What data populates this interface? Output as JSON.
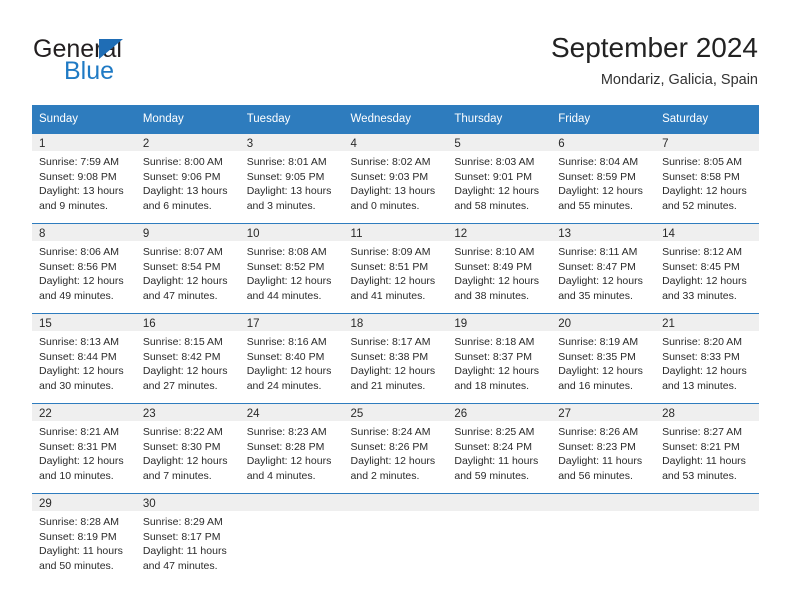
{
  "brand": {
    "name_top": "General",
    "name_bottom": "Blue",
    "triangle_color": "#1f6db5",
    "blue_text_color": "#1f7ac4"
  },
  "header": {
    "title": "September 2024",
    "subtitle": "Mondariz, Galicia, Spain"
  },
  "theme": {
    "header_row_bg": "#2e7cbe",
    "header_row_text": "#ffffff",
    "daynum_band_bg": "#efefef",
    "cell_border": "#2e7cbe",
    "page_bg": "#ffffff",
    "body_text": "#2a2a2a"
  },
  "weekday_headers": [
    "Sunday",
    "Monday",
    "Tuesday",
    "Wednesday",
    "Thursday",
    "Friday",
    "Saturday"
  ],
  "weeks": [
    [
      {
        "day": "1",
        "lines": [
          "Sunrise: 7:59 AM",
          "Sunset: 9:08 PM",
          "Daylight: 13 hours",
          "and 9 minutes."
        ]
      },
      {
        "day": "2",
        "lines": [
          "Sunrise: 8:00 AM",
          "Sunset: 9:06 PM",
          "Daylight: 13 hours",
          "and 6 minutes."
        ]
      },
      {
        "day": "3",
        "lines": [
          "Sunrise: 8:01 AM",
          "Sunset: 9:05 PM",
          "Daylight: 13 hours",
          "and 3 minutes."
        ]
      },
      {
        "day": "4",
        "lines": [
          "Sunrise: 8:02 AM",
          "Sunset: 9:03 PM",
          "Daylight: 13 hours",
          "and 0 minutes."
        ]
      },
      {
        "day": "5",
        "lines": [
          "Sunrise: 8:03 AM",
          "Sunset: 9:01 PM",
          "Daylight: 12 hours",
          "and 58 minutes."
        ]
      },
      {
        "day": "6",
        "lines": [
          "Sunrise: 8:04 AM",
          "Sunset: 8:59 PM",
          "Daylight: 12 hours",
          "and 55 minutes."
        ]
      },
      {
        "day": "7",
        "lines": [
          "Sunrise: 8:05 AM",
          "Sunset: 8:58 PM",
          "Daylight: 12 hours",
          "and 52 minutes."
        ]
      }
    ],
    [
      {
        "day": "8",
        "lines": [
          "Sunrise: 8:06 AM",
          "Sunset: 8:56 PM",
          "Daylight: 12 hours",
          "and 49 minutes."
        ]
      },
      {
        "day": "9",
        "lines": [
          "Sunrise: 8:07 AM",
          "Sunset: 8:54 PM",
          "Daylight: 12 hours",
          "and 47 minutes."
        ]
      },
      {
        "day": "10",
        "lines": [
          "Sunrise: 8:08 AM",
          "Sunset: 8:52 PM",
          "Daylight: 12 hours",
          "and 44 minutes."
        ]
      },
      {
        "day": "11",
        "lines": [
          "Sunrise: 8:09 AM",
          "Sunset: 8:51 PM",
          "Daylight: 12 hours",
          "and 41 minutes."
        ]
      },
      {
        "day": "12",
        "lines": [
          "Sunrise: 8:10 AM",
          "Sunset: 8:49 PM",
          "Daylight: 12 hours",
          "and 38 minutes."
        ]
      },
      {
        "day": "13",
        "lines": [
          "Sunrise: 8:11 AM",
          "Sunset: 8:47 PM",
          "Daylight: 12 hours",
          "and 35 minutes."
        ]
      },
      {
        "day": "14",
        "lines": [
          "Sunrise: 8:12 AM",
          "Sunset: 8:45 PM",
          "Daylight: 12 hours",
          "and 33 minutes."
        ]
      }
    ],
    [
      {
        "day": "15",
        "lines": [
          "Sunrise: 8:13 AM",
          "Sunset: 8:44 PM",
          "Daylight: 12 hours",
          "and 30 minutes."
        ]
      },
      {
        "day": "16",
        "lines": [
          "Sunrise: 8:15 AM",
          "Sunset: 8:42 PM",
          "Daylight: 12 hours",
          "and 27 minutes."
        ]
      },
      {
        "day": "17",
        "lines": [
          "Sunrise: 8:16 AM",
          "Sunset: 8:40 PM",
          "Daylight: 12 hours",
          "and 24 minutes."
        ]
      },
      {
        "day": "18",
        "lines": [
          "Sunrise: 8:17 AM",
          "Sunset: 8:38 PM",
          "Daylight: 12 hours",
          "and 21 minutes."
        ]
      },
      {
        "day": "19",
        "lines": [
          "Sunrise: 8:18 AM",
          "Sunset: 8:37 PM",
          "Daylight: 12 hours",
          "and 18 minutes."
        ]
      },
      {
        "day": "20",
        "lines": [
          "Sunrise: 8:19 AM",
          "Sunset: 8:35 PM",
          "Daylight: 12 hours",
          "and 16 minutes."
        ]
      },
      {
        "day": "21",
        "lines": [
          "Sunrise: 8:20 AM",
          "Sunset: 8:33 PM",
          "Daylight: 12 hours",
          "and 13 minutes."
        ]
      }
    ],
    [
      {
        "day": "22",
        "lines": [
          "Sunrise: 8:21 AM",
          "Sunset: 8:31 PM",
          "Daylight: 12 hours",
          "and 10 minutes."
        ]
      },
      {
        "day": "23",
        "lines": [
          "Sunrise: 8:22 AM",
          "Sunset: 8:30 PM",
          "Daylight: 12 hours",
          "and 7 minutes."
        ]
      },
      {
        "day": "24",
        "lines": [
          "Sunrise: 8:23 AM",
          "Sunset: 8:28 PM",
          "Daylight: 12 hours",
          "and 4 minutes."
        ]
      },
      {
        "day": "25",
        "lines": [
          "Sunrise: 8:24 AM",
          "Sunset: 8:26 PM",
          "Daylight: 12 hours",
          "and 2 minutes."
        ]
      },
      {
        "day": "26",
        "lines": [
          "Sunrise: 8:25 AM",
          "Sunset: 8:24 PM",
          "Daylight: 11 hours",
          "and 59 minutes."
        ]
      },
      {
        "day": "27",
        "lines": [
          "Sunrise: 8:26 AM",
          "Sunset: 8:23 PM",
          "Daylight: 11 hours",
          "and 56 minutes."
        ]
      },
      {
        "day": "28",
        "lines": [
          "Sunrise: 8:27 AM",
          "Sunset: 8:21 PM",
          "Daylight: 11 hours",
          "and 53 minutes."
        ]
      }
    ],
    [
      {
        "day": "29",
        "lines": [
          "Sunrise: 8:28 AM",
          "Sunset: 8:19 PM",
          "Daylight: 11 hours",
          "and 50 minutes."
        ]
      },
      {
        "day": "30",
        "lines": [
          "Sunrise: 8:29 AM",
          "Sunset: 8:17 PM",
          "Daylight: 11 hours",
          "and 47 minutes."
        ]
      },
      {
        "day": "",
        "lines": []
      },
      {
        "day": "",
        "lines": []
      },
      {
        "day": "",
        "lines": []
      },
      {
        "day": "",
        "lines": []
      },
      {
        "day": "",
        "lines": []
      }
    ]
  ]
}
